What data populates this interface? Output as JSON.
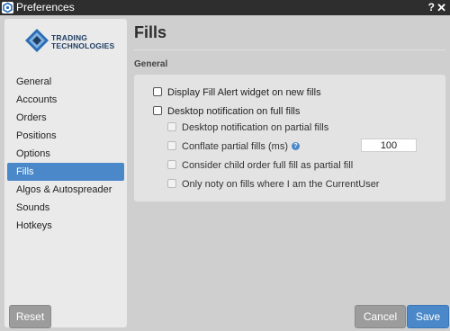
{
  "window": {
    "title": "Preferences",
    "help_label": "?",
    "close_label": "✕"
  },
  "logo": {
    "line1": "TRADING",
    "line2": "TECHNOLOGIES"
  },
  "sidebar": {
    "items": [
      {
        "label": "General"
      },
      {
        "label": "Accounts"
      },
      {
        "label": "Orders"
      },
      {
        "label": "Positions"
      },
      {
        "label": "Options"
      },
      {
        "label": "Fills"
      },
      {
        "label": "Algos & Autospreader"
      },
      {
        "label": "Sounds"
      },
      {
        "label": "Hotkeys"
      }
    ],
    "active_index": 5,
    "reset_label": "Reset"
  },
  "main": {
    "heading": "Fills",
    "section_label": "General",
    "options": {
      "display_fill_alert": {
        "label": "Display Fill Alert widget on new fills",
        "checked": false
      },
      "desktop_notification_full": {
        "label": "Desktop notification on full fills",
        "checked": false
      },
      "desktop_notification_partial": {
        "label": "Desktop notification on partial fills",
        "checked": false,
        "disabled": true
      },
      "conflate_partial": {
        "label": "Conflate partial fills (ms)",
        "checked": false,
        "disabled": true,
        "value": "100"
      },
      "child_order_full": {
        "label": "Consider child order full fill as partial fill",
        "checked": false,
        "disabled": true
      },
      "only_current_user": {
        "label": "Only noty on fills where I am the CurrentUser",
        "checked": false,
        "disabled": true
      }
    }
  },
  "footer": {
    "cancel_label": "Cancel",
    "save_label": "Save"
  },
  "colors": {
    "accent": "#4a88c9",
    "titlebar": "#2e2e2e",
    "sidebar_bg": "#eaeaea"
  }
}
